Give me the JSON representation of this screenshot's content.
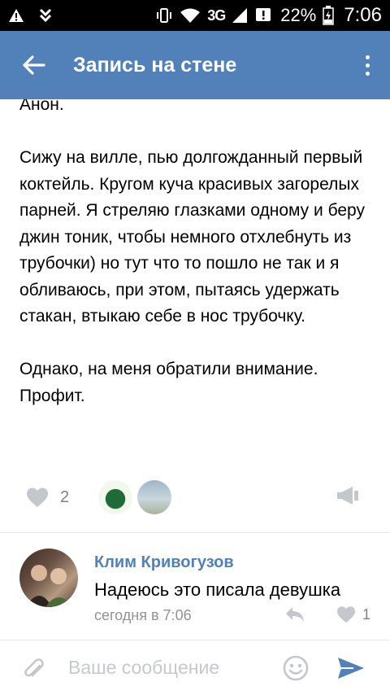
{
  "status_bar": {
    "network": "3G",
    "battery": "22%",
    "time": "7:06"
  },
  "app_bar": {
    "title": "Запись на стене"
  },
  "post": {
    "text": "Анон.\n\nСижу на вилле, пью долгожданный первый  коктейль. Кругом куча красивых загорелых парней. Я стреляю глазками одному и беру джин тоник, чтобы немного отхлебнуть из трубочки) но тут что то пошло не так и я обливаюсь, при этом, пытаясь удержать стакан, втыкаю себе в нос трубочку.\n\nОднако, на меня обратили внимание. Профит."
  },
  "actions": {
    "like_count": "2"
  },
  "comment": {
    "author": "Клим Кривогузов",
    "text": "Надеюсь это писала девушка",
    "time": "сегодня в 7:06",
    "like_count": "1"
  },
  "composer": {
    "placeholder": "Ваше сообщение"
  },
  "colors": {
    "accent": "#5181b8",
    "secondary_text": "#828282",
    "icon_gray": "#c4c8cd"
  },
  "icons": [
    "warning-icon",
    "download-icon",
    "vibrate-icon",
    "wifi-icon",
    "signal-icon",
    "notification-icon",
    "battery-icon",
    "back-arrow-icon",
    "more-vert-icon",
    "heart-icon",
    "megaphone-icon",
    "reply-icon",
    "paperclip-icon",
    "emoji-icon",
    "send-icon"
  ]
}
